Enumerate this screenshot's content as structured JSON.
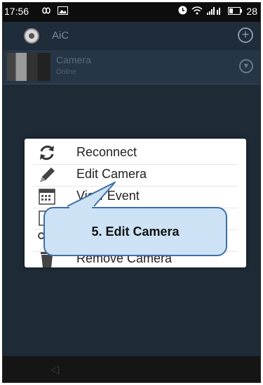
{
  "status_bar": {
    "time": "17:56",
    "battery": "28",
    "icons": [
      "infinity-icon",
      "image-icon",
      "alarm-icon",
      "wifi-icon",
      "signal-icon",
      "battery-icon"
    ]
  },
  "app": {
    "title": "AiC",
    "add_icon": "plus-circle-icon"
  },
  "camera": {
    "name": "Camera",
    "status": "Online"
  },
  "menu": {
    "items": [
      {
        "label": "Reconnect",
        "icon": "refresh-icon"
      },
      {
        "label": "Edit Camera",
        "icon": "pencil-icon"
      },
      {
        "label": "View Event",
        "icon": "calendar-icon"
      },
      {
        "label": "",
        "icon": "photo-icon"
      },
      {
        "label": "",
        "icon": "settings-icon"
      },
      {
        "label": "Remove Camera",
        "icon": "trash-icon"
      }
    ]
  },
  "callout": {
    "text": "5. Edit Camera"
  },
  "colors": {
    "app_background": "#1e2a36",
    "callout_fill": "#cde2f5",
    "callout_border": "#3e6fa8"
  }
}
